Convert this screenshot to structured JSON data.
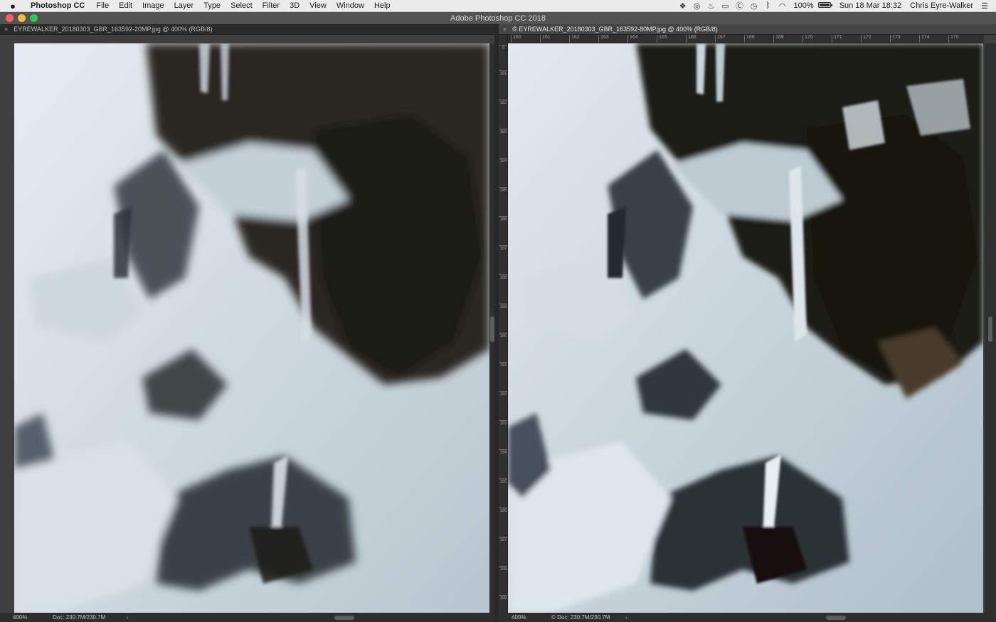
{
  "menubar": {
    "apple": "",
    "app_name": "Photoshop CC",
    "menus": [
      "File",
      "Edit",
      "Image",
      "Layer",
      "Type",
      "Select",
      "Filter",
      "3D",
      "View",
      "Window",
      "Help"
    ],
    "status_icons": [
      "dropbox-icon",
      "creative-cloud-icon",
      "flame-icon",
      "display-icon",
      "c-icon",
      "time-machine-icon",
      "bluetooth-icon",
      "wifi-icon"
    ],
    "battery_percent": "100%",
    "battery_level": 1.0,
    "clock": "Sun 18 Mar  18:32",
    "user": "Chris Eyre-Walker",
    "list_icon": "notification-list-icon"
  },
  "titlebar": {
    "title": "Adobe Photoshop CC 2018"
  },
  "documents": [
    {
      "tab_close": "×",
      "tab_title": "EYREWALKER_20180303_GBR_163592-20MP.jpg @ 400% (RGB/8)",
      "zoom": "400%",
      "doc_size": "Doc: 230.7M/230.7M",
      "status_arrow": "›"
    },
    {
      "tab_close": "×",
      "tab_title": "© EYREWALKER_20180303_GBR_163592-80MP.jpg @ 400% (RGB/8)",
      "zoom": "400%",
      "doc_size": "© Doc: 230.7M/230.7M",
      "status_arrow": "›",
      "ruler_top": [
        "160",
        "161",
        "162",
        "163",
        "164",
        "165",
        "166",
        "167",
        "168",
        "169",
        "170",
        "171",
        "172",
        "173",
        "174",
        "175"
      ],
      "ruler_left": [
        "0",
        "181",
        "182",
        "183",
        "184",
        "185",
        "186",
        "187",
        "188",
        "189",
        "190",
        "191",
        "192",
        "193",
        "194",
        "195",
        "196",
        "197",
        "198",
        "199"
      ]
    }
  ],
  "colors": {
    "ice_light": "#dfe7ec",
    "ice_mid": "#b9c7cf",
    "rock_dark": "#23201c",
    "rock_brown": "#3d3024"
  }
}
